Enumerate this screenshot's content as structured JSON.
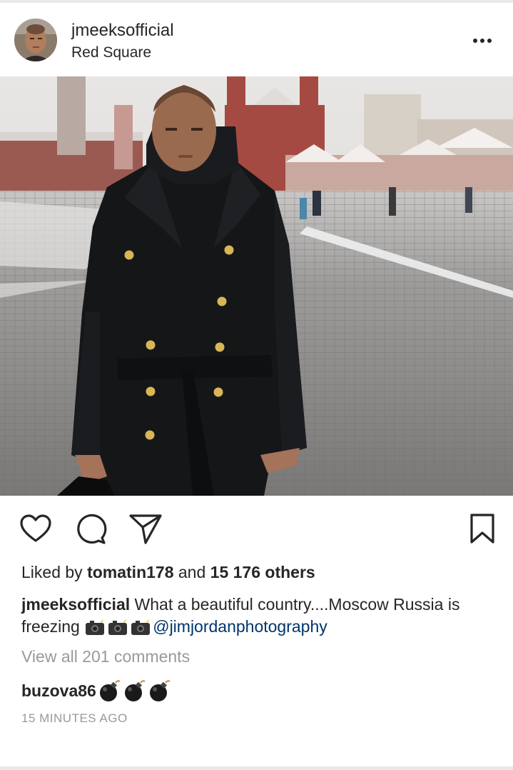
{
  "post": {
    "username": "jmeeksofficial",
    "location": "Red Square",
    "likes": {
      "prefix": "Liked by ",
      "liker": "tomatin178",
      "middle": " and ",
      "others": "15 176 others"
    },
    "caption": {
      "username": "jmeeksofficial",
      "text": " What a beautiful country....Moscow Russia is freezing ",
      "emojis": [
        "camera-flash-emoji",
        "camera-flash-emoji",
        "camera-flash-emoji"
      ],
      "mention": "@jimjordanphotography"
    },
    "view_all_comments": "View all 201 comments",
    "comments": [
      {
        "username": "buzova86",
        "emojis": [
          "bomb-emoji",
          "bomb-emoji",
          "bomb-emoji"
        ]
      }
    ],
    "timestamp": "15 MINUTES AGO"
  },
  "icons": {
    "more": "more-options-icon",
    "like": "heart-icon",
    "comment": "comment-icon",
    "share": "paper-plane-icon",
    "save": "bookmark-icon"
  },
  "colors": {
    "text": "#262626",
    "muted": "#999999",
    "mention": "#003569",
    "divider": "#efefef"
  }
}
